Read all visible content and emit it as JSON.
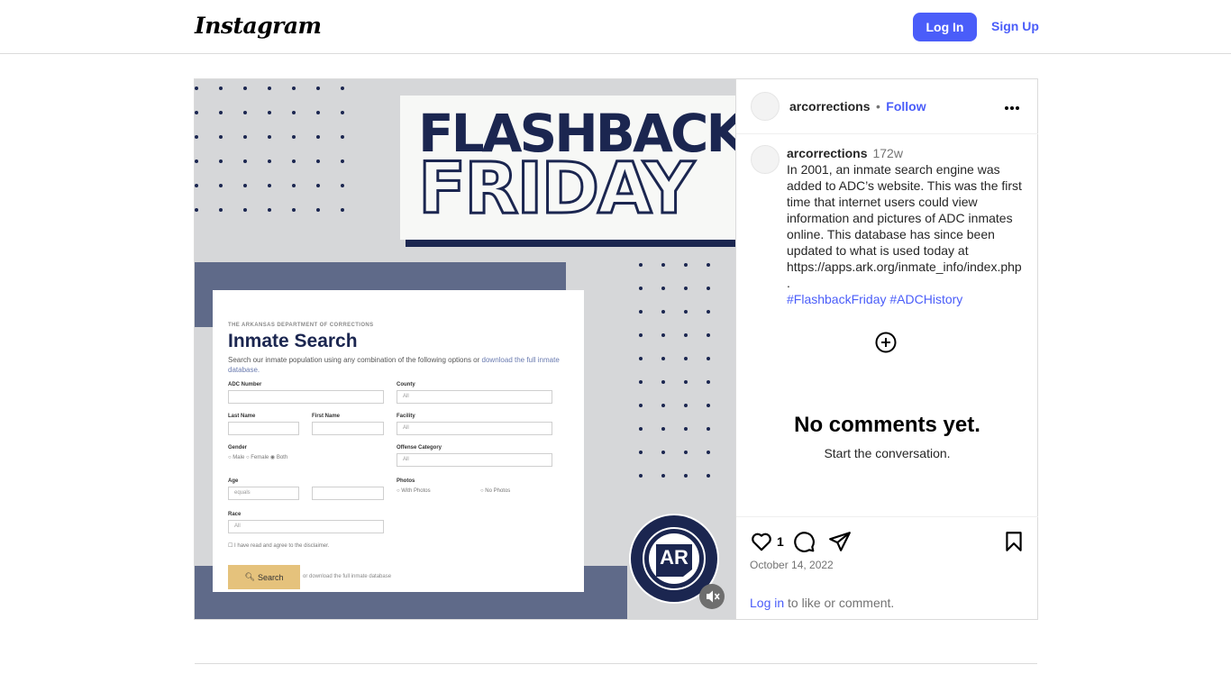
{
  "header": {
    "logo_text": "Instagram",
    "login_label": "Log In",
    "signup_label": "Sign Up"
  },
  "post": {
    "author": "arcorrections",
    "follow_label": "Follow",
    "follow_separator": "•",
    "caption_author": "arcorrections",
    "caption_age": "172w",
    "caption_text": "In 2001, an inmate search engine was added to ADC’s website. This was the first time that internet users could view information and pictures of ADC inmates online. This database has since been updated to what is used today at https://apps.ark.org/inmate_info/index.php.",
    "hashtags": "#FlashbackFriday #ADCHistory",
    "no_comments_title": "No comments yet.",
    "no_comments_sub": "Start the conversation.",
    "likes_count": "1",
    "date": "October 14, 2022",
    "login_link": "Log in",
    "login_suffix": " to like or comment."
  },
  "media": {
    "flashback_line1": "FLASHBACK",
    "flashback_line2": "FRIDAY",
    "shot_dept": "THE ARKANSAS DEPARTMENT OF CORRECTIONS",
    "shot_title": "Inmate Search",
    "shot_desc_1": "Search our inmate population using any combination of the following options or ",
    "shot_desc_link": "download the full inmate database.",
    "labels": {
      "adc_number": "ADC Number",
      "county": "County",
      "last_name": "Last Name",
      "first_name": "First Name",
      "facility": "Facility",
      "gender": "Gender",
      "offense_category": "Offense Category",
      "age": "Age",
      "photos": "Photos",
      "race": "Race"
    },
    "values": {
      "county": "All",
      "facility": "All",
      "offense": "All",
      "age_op": "equals",
      "race": "All"
    },
    "gender_options": "○ Male  ○ Female  ◉ Both",
    "photo_with": "○ With Photos",
    "photo_without": "○ No Photos",
    "disclaimer": "☐ I have read and agree to the disclaimer.",
    "search_btn": "Search",
    "alt_download": "or download the full inmate database",
    "seal_text": "AR"
  }
}
